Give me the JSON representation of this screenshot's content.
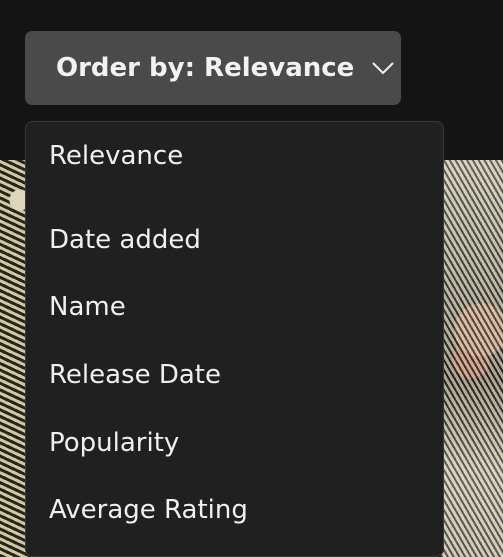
{
  "order_button": {
    "label": "Order by: Relevance"
  },
  "menu": {
    "items": [
      {
        "label": "Relevance"
      },
      {
        "label": "Date added"
      },
      {
        "label": "Name"
      },
      {
        "label": "Release Date"
      },
      {
        "label": "Popularity"
      },
      {
        "label": "Average Rating"
      }
    ]
  },
  "colors": {
    "page_bg": "#141414",
    "button_bg": "#4a4a4a",
    "menu_bg": "#202020",
    "text": "#f0f0f0"
  }
}
